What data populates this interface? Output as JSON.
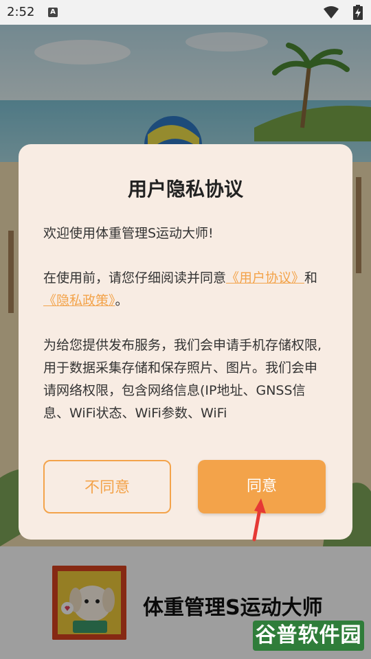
{
  "status_bar": {
    "time": "2:52",
    "notification_icon": "a-icon",
    "wifi_icon": "wifi-icon",
    "battery_icon": "battery-charging-icon"
  },
  "dialog": {
    "title": "用户隐私协议",
    "welcome": "欢迎使用体重管理S运动大师!",
    "intro_prefix": "在使用前，请您仔细阅读并同意",
    "user_agreement_link": "《用户协议》",
    "and_text": "和",
    "privacy_policy_link": "《隐私政策》",
    "intro_suffix": "。",
    "permissions_text": "为给您提供发布服务，我们会申请手机存储权限, 用于数据采集存储和保存照片、图片。我们会申请网络权限，包含网络信息(IP地址、GNSS信息、WiFi状态、WiFi参数、WiFi",
    "disagree_button": "不同意",
    "agree_button": "同意"
  },
  "app_bar": {
    "app_name": "体重管理S运动大师"
  },
  "watermark": {
    "text": "谷普软件园"
  },
  "colors": {
    "accent": "#f3a34a",
    "dialog_bg": "#f8ece3",
    "arrow": "#e53935"
  }
}
